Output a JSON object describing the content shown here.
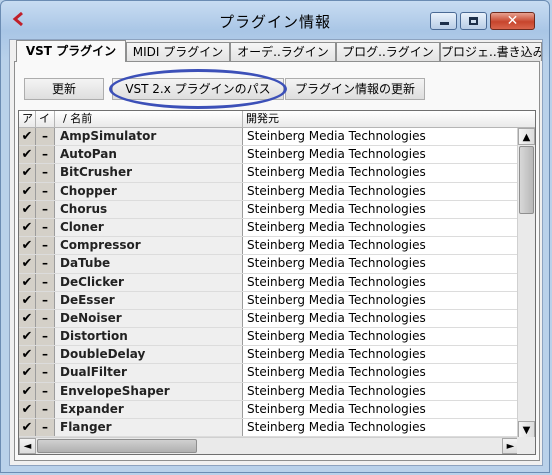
{
  "window": {
    "title": "プラグイン情報",
    "app_icon": "steinberg-logo-icon",
    "controls": {
      "minimize": "minimize-icon",
      "maximize": "maximize-icon",
      "close": "✕"
    }
  },
  "tabs": [
    {
      "label": "VST プラグイン",
      "active": true
    },
    {
      "label": "MIDI プラグイン",
      "active": false
    },
    {
      "label": "オーデ..ラグイン",
      "active": false
    },
    {
      "label": "プログ..ラグイン",
      "active": false
    },
    {
      "label": "プロジェ..書き込み",
      "active": false
    }
  ],
  "toolbar": {
    "update_label": "更新",
    "vst2_path_label": "VST 2.x プラグインのパス",
    "update_info_label": "プラグイン情報の更新"
  },
  "columns": {
    "active": "ア",
    "instance": "イ",
    "name": "/ 名前",
    "vendor": "開発元"
  },
  "rows": [
    {
      "active": "✔",
      "instance": "–",
      "name": "AmpSimulator",
      "vendor": "Steinberg Media Technologies"
    },
    {
      "active": "✔",
      "instance": "–",
      "name": "AutoPan",
      "vendor": "Steinberg Media Technologies"
    },
    {
      "active": "✔",
      "instance": "–",
      "name": "BitCrusher",
      "vendor": "Steinberg Media Technologies"
    },
    {
      "active": "✔",
      "instance": "–",
      "name": "Chopper",
      "vendor": "Steinberg Media Technologies"
    },
    {
      "active": "✔",
      "instance": "–",
      "name": "Chorus",
      "vendor": "Steinberg Media Technologies"
    },
    {
      "active": "✔",
      "instance": "–",
      "name": "Cloner",
      "vendor": "Steinberg Media Technologies"
    },
    {
      "active": "✔",
      "instance": "–",
      "name": "Compressor",
      "vendor": "Steinberg Media Technologies"
    },
    {
      "active": "✔",
      "instance": "–",
      "name": "DaTube",
      "vendor": "Steinberg Media Technologies"
    },
    {
      "active": "✔",
      "instance": "–",
      "name": "DeClicker",
      "vendor": "Steinberg Media Technologies"
    },
    {
      "active": "✔",
      "instance": "–",
      "name": "DeEsser",
      "vendor": "Steinberg Media Technologies"
    },
    {
      "active": "✔",
      "instance": "–",
      "name": "DeNoiser",
      "vendor": "Steinberg Media Technologies"
    },
    {
      "active": "✔",
      "instance": "–",
      "name": "Distortion",
      "vendor": "Steinberg Media Technologies"
    },
    {
      "active": "✔",
      "instance": "–",
      "name": "DoubleDelay",
      "vendor": "Steinberg Media Technologies"
    },
    {
      "active": "✔",
      "instance": "–",
      "name": "DualFilter",
      "vendor": "Steinberg Media Technologies"
    },
    {
      "active": "✔",
      "instance": "–",
      "name": "EnvelopeShaper",
      "vendor": "Steinberg Media Technologies"
    },
    {
      "active": "✔",
      "instance": "–",
      "name": "Expander",
      "vendor": "Steinberg Media Technologies"
    },
    {
      "active": "✔",
      "instance": "–",
      "name": "Flanger",
      "vendor": "Steinberg Media Technologies"
    }
  ],
  "scroll": {
    "up": "▲",
    "down": "▼",
    "left": "◄",
    "right": "►"
  }
}
